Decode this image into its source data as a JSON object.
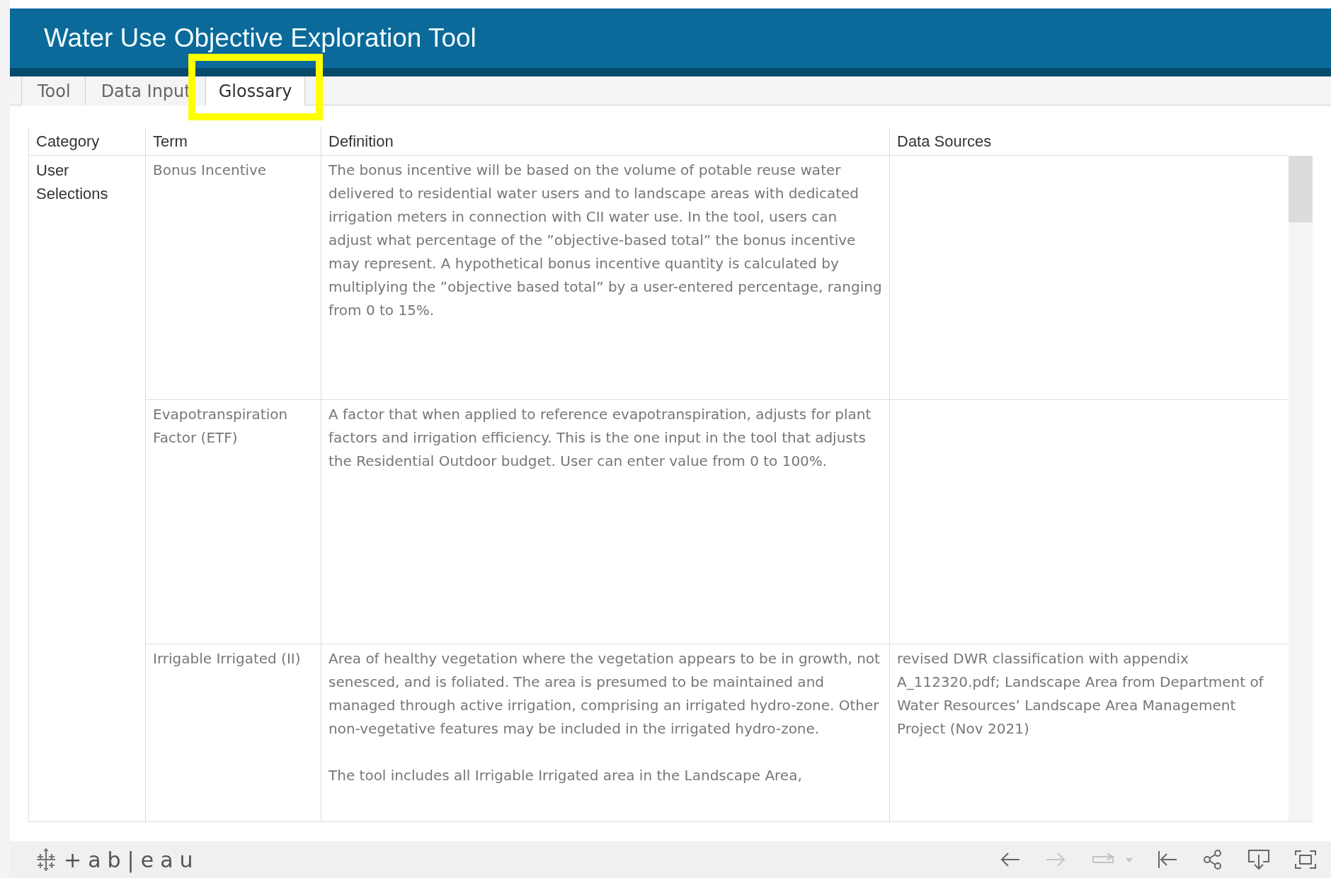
{
  "header": {
    "title": "Water Use Objective Exploration Tool"
  },
  "tabs": [
    {
      "label": "Tool",
      "selected": false,
      "highlighted": false
    },
    {
      "label": "Data Input",
      "selected": false,
      "highlighted": false
    },
    {
      "label": "Glossary",
      "selected": true,
      "highlighted": true
    }
  ],
  "table": {
    "columns": [
      "Category",
      "Term",
      "Definition",
      "Data Sources"
    ],
    "category": "User Selections",
    "rows": [
      {
        "term": "Bonus Incentive",
        "definition": [
          "The bonus incentive will be based on the volume of potable reuse water delivered to residential water users and to landscape areas with dedicated irrigation meters in connection with CII water use. In the tool, users can adjust what percentage of the ”objective-based total” the bonus incentive may represent. A hypothetical bonus incentive quantity is calculated by multiplying the ”objective based total” by a user-entered percentage, ranging from 0 to 15%."
        ],
        "sources": ""
      },
      {
        "term": "Evapotranspiration Factor (ETF)",
        "definition": [
          "A factor that when applied to reference evapotranspiration, adjusts for plant factors and irrigation efficiency. This is the one input in the tool that adjusts the Residential Outdoor budget. User can enter value from 0 to 100%."
        ],
        "sources": ""
      },
      {
        "term": "Irrigable Irrigated (II)",
        "definition": [
          "Area of healthy vegetation where the vegetation appears to be in growth, not senesced, and is foliated. The area is presumed to be maintained and managed through active irrigation, comprising an irrigated hydro-zone. Other non-vegetative features may be included in the irrigated hydro-zone.",
          "The tool includes all Irrigable Irrigated area in the Landscape Area,"
        ],
        "sources": "revised DWR classification with appendix A_112320.pdf; Landscape Area from Department of Water Resources’ Landscape Area Management Project (Nov 2021)"
      }
    ]
  },
  "footer": {
    "logo": "+ab|eau",
    "tools": [
      {
        "kind": "undo",
        "disabled": false
      },
      {
        "kind": "redo",
        "disabled": true
      },
      {
        "kind": "revert",
        "disabled": true
      },
      {
        "kind": "start",
        "disabled": false
      },
      {
        "kind": "share",
        "disabled": false
      },
      {
        "kind": "download",
        "disabled": false
      },
      {
        "kind": "fullscreen",
        "disabled": false
      }
    ]
  }
}
